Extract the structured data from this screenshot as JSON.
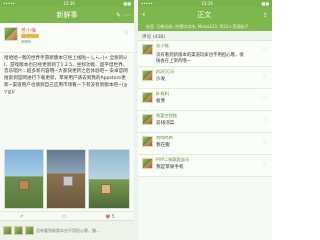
{
  "left": {
    "status": {
      "signal": "•••••",
      "time": "15:36",
      "battery": "■■"
    },
    "nav": {
      "title": "新鲜事",
      "edit_icon": "edit-icon",
      "more_icon": "more-icon"
    },
    "author": {
      "name": "苦小柚"
    },
    "body": "哈哈哈~我的世界手游新版本已经上线啦~ (｡•̀ᴗ-)✧ 全新的UI，游戏版本也已经更新到了1.2.5，坐标功能、超平坦世界、音乐唱片...超多新内容哦~大家快更新之后体验吧~ 安卓官网搜索到官网进行下载更新，苹果用户请去到我的Appstore更新~渠道用户也请到自己应用市场看一下有没有新版本吧~(≧▽≦)/",
    "actions": {
      "share": "",
      "comments": "",
      "likes": "5"
    },
    "replybar": {
      "hint": "没有看到新版本也不用担心哦，慢..."
    }
  },
  "right": {
    "status": {
      "signal": "•••••",
      "time": "15:36",
      "battery": "■■"
    },
    "nav": {
      "title": "正文",
      "back": "‹",
      "share_icon": "share-icon"
    },
    "tags": "标签: 功能动态, 柠檬冰凉凉, Molze233, 等20人受理帖子",
    "count": "评论 (438)",
    "replies": [
      {
        "name": "苦小柚",
        "text1": "没有看到新版本的渠道玩家也不用担心哦，很",
        "text2": "快会在上架的哦~"
      },
      {
        "name": "JIQ乐打水",
        "text": "沙发"
      },
      {
        "name": "N-耗料",
        "text": "板凳"
      },
      {
        "name": "熟菜空视频",
        "text": "前排涼菜"
      },
      {
        "name": "呜呜呜呜",
        "text": "我在搬"
      },
      {
        "name": "PVP二狗蔬蔬血马",
        "text": "我是苹果手机"
      }
    ]
  }
}
